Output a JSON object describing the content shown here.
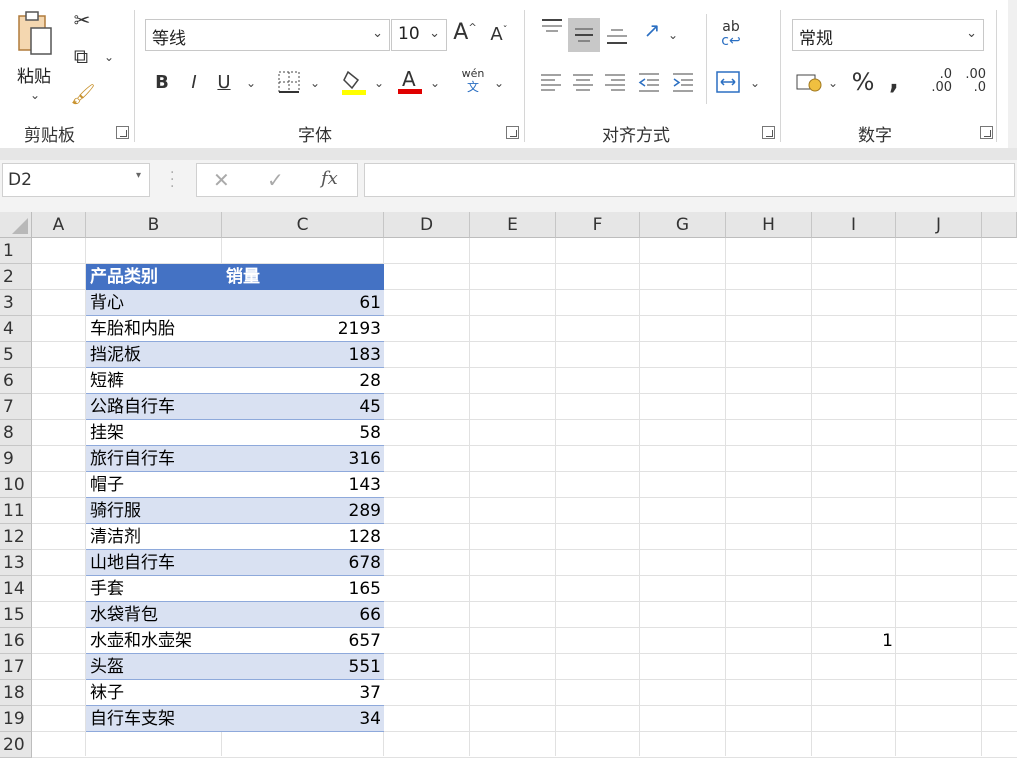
{
  "ribbon": {
    "clipboard": {
      "label": "剪贴板",
      "paste_label": "粘贴"
    },
    "font": {
      "label": "字体",
      "font_name": "等线",
      "font_size": "10",
      "phonetic_top": "wén",
      "phonetic_bottom": "文"
    },
    "alignment": {
      "label": "对齐方式"
    },
    "number": {
      "label": "数字",
      "format": "常规",
      "inc_decimal_top": ".0",
      "inc_decimal_bottom": ".00",
      "dec_decimal_top": ".00",
      "dec_decimal_bottom": ".0"
    },
    "accent_highlight": "#ffff00",
    "accent_font_color": "#e00000"
  },
  "formula_bar": {
    "name_box": "D2",
    "formula": ""
  },
  "columns": [
    "A",
    "B",
    "C",
    "D",
    "E",
    "F",
    "G",
    "H",
    "I",
    "J"
  ],
  "rows": [
    "1",
    "2",
    "3",
    "4",
    "5",
    "6",
    "7",
    "8",
    "9",
    "10",
    "11",
    "12",
    "13",
    "14",
    "15",
    "16",
    "17",
    "18",
    "19",
    "20"
  ],
  "table": {
    "header": [
      "产品类别",
      "销量"
    ],
    "rows": [
      [
        "背心",
        "61"
      ],
      [
        "车胎和内胎",
        "2193"
      ],
      [
        "挡泥板",
        "183"
      ],
      [
        "短裤",
        "28"
      ],
      [
        "公路自行车",
        "45"
      ],
      [
        "挂架",
        "58"
      ],
      [
        "旅行自行车",
        "316"
      ],
      [
        "帽子",
        "143"
      ],
      [
        "骑行服",
        "289"
      ],
      [
        "清洁剂",
        "128"
      ],
      [
        "山地自行车",
        "678"
      ],
      [
        "手套",
        "165"
      ],
      [
        "水袋背包",
        "66"
      ],
      [
        "水壶和水壶架",
        "657"
      ],
      [
        "头盔",
        "551"
      ],
      [
        "袜子",
        "37"
      ],
      [
        "自行车支架",
        "34"
      ]
    ],
    "header_color": "#4472c4",
    "band_color": "#d9e1f2"
  },
  "extra_cell": {
    "ref": "I16",
    "value": "1"
  }
}
